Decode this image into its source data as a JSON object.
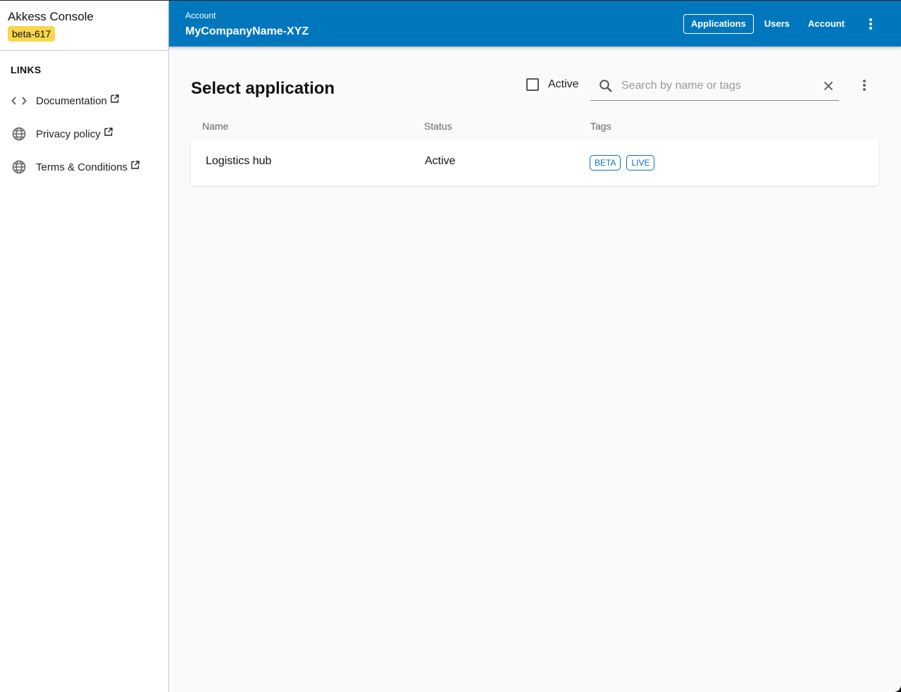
{
  "sidebar": {
    "app_title": "Akkess Console",
    "env_badge": "beta-617",
    "links_heading": "LINKS",
    "links": [
      {
        "label": "Documentation",
        "icon": "code-icon"
      },
      {
        "label": "Privacy policy",
        "icon": "globe-icon"
      },
      {
        "label": "Terms & Conditions",
        "icon": "globe-icon"
      }
    ]
  },
  "topbar": {
    "account_label": "Account",
    "account_name": "MyCompanyName-XYZ",
    "nav": [
      {
        "label": "Applications",
        "active": true
      },
      {
        "label": "Users",
        "active": false
      },
      {
        "label": "Account",
        "active": false
      }
    ]
  },
  "main": {
    "title": "Select application",
    "active_filter_label": "Active",
    "active_filter_checked": false,
    "search": {
      "value": "",
      "placeholder": "Search by name or tags"
    },
    "columns": [
      "Name",
      "Status",
      "Tags"
    ],
    "rows": [
      {
        "name": "Logistics hub",
        "status": "Active",
        "tags": [
          "BETA",
          "LIVE"
        ]
      }
    ]
  },
  "colors": {
    "topbar": "#0077bd",
    "badge": "#f8d64e",
    "tag": "#0a73b6"
  }
}
